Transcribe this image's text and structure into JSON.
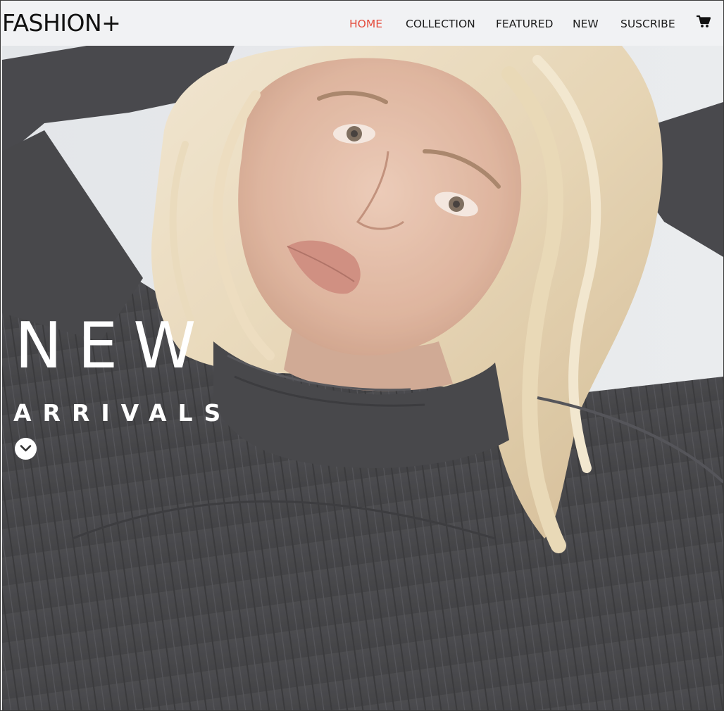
{
  "brand": {
    "logo": "FASHION+"
  },
  "nav": {
    "home": "HOME",
    "collection": "COLLECTION",
    "featured": "FEATURED",
    "new": "NEW",
    "subscribe": "SUSCRIBE",
    "active_color": "#e44c3c",
    "cart_icon": "shopping-cart-icon"
  },
  "hero": {
    "title": "NEW",
    "subtitle": "ARRIVALS",
    "scroll_icon": "chevron-down-icon"
  }
}
